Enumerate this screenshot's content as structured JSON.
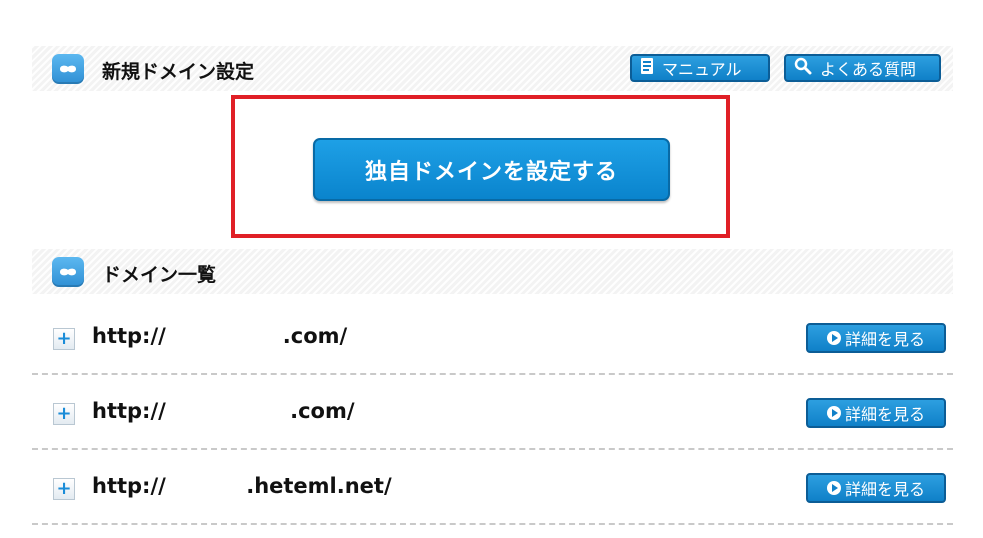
{
  "section_new": {
    "title": "新規ドメイン設定",
    "manual_label": "マニュアル",
    "faq_label": "よくある質問"
  },
  "main_action": {
    "label": "独自ドメインを設定する"
  },
  "section_list": {
    "title": "ドメイン一覧"
  },
  "domains": [
    {
      "url": "http://                .com/",
      "detail_label": "詳細を見る"
    },
    {
      "url": "http://                 .com/",
      "detail_label": "詳細を見る"
    },
    {
      "url": "http://           .heteml.net/",
      "detail_label": "詳細を見る"
    }
  ],
  "colors": {
    "primary_blue": "#0f80c8",
    "highlight_red": "#e01f26"
  }
}
